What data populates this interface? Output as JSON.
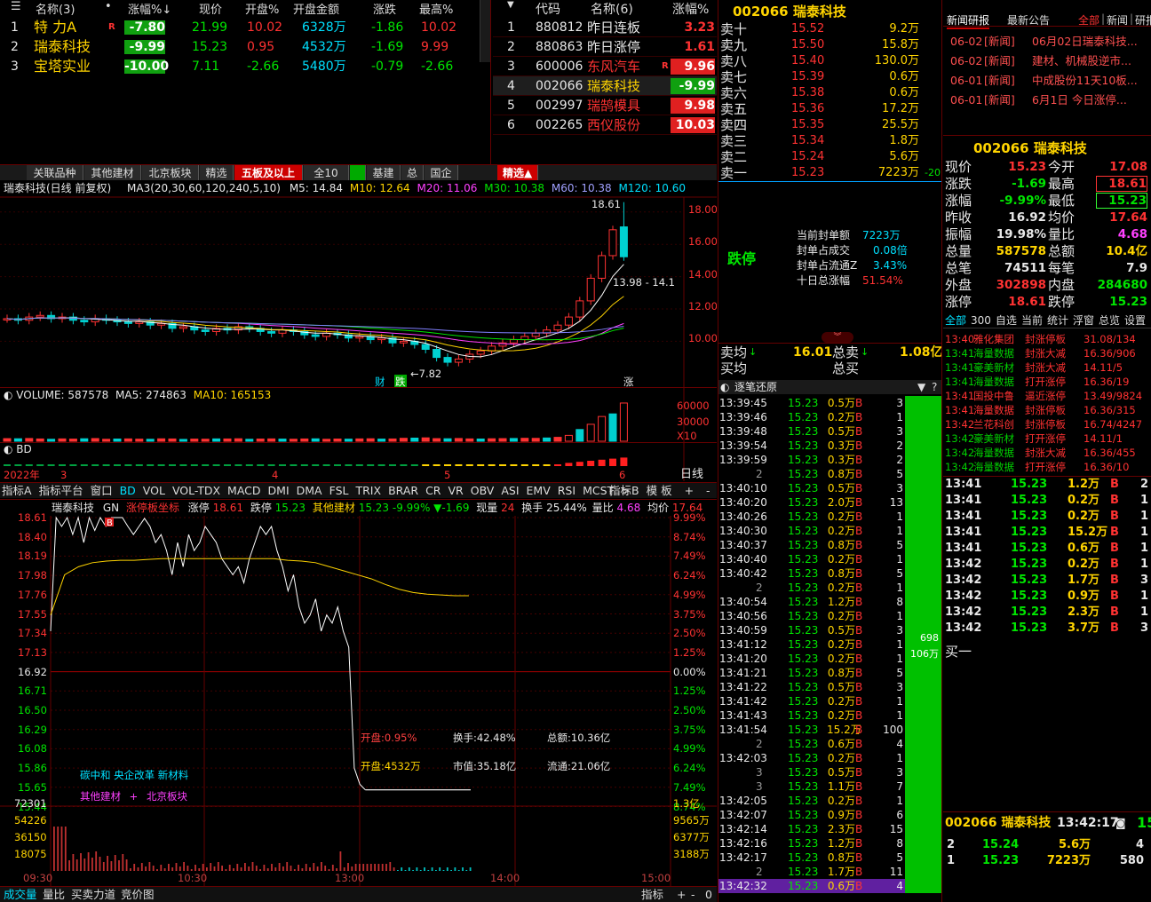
{
  "wl1": {
    "headers": [
      "名称(3)",
      "•",
      "涨幅%↓",
      "现价",
      "开盘%",
      "开盘金额",
      "涨跌",
      "最高%"
    ],
    "rows": [
      {
        "n": "1",
        "name": "特 力A",
        "tag": "R",
        "chg": "-7.80",
        "price": "21.99",
        "open": "10.02",
        "amt": "6328万",
        "diff": "-1.86",
        "high": "10.02"
      },
      {
        "n": "2",
        "name": "瑞泰科技",
        "tag": "",
        "chg": "-9.99",
        "price": "15.23",
        "open": "0.95",
        "amt": "4532万",
        "diff": "-1.69",
        "high": "9.99"
      },
      {
        "n": "3",
        "name": "宝塔实业",
        "tag": "",
        "chg": "-10.00",
        "price": "7.11",
        "open": "-2.66",
        "amt": "5480万",
        "diff": "-0.79",
        "high": "-2.66"
      }
    ]
  },
  "wl2": {
    "headers": [
      "代码",
      "名称(6)",
      "涨幅%"
    ],
    "rows": [
      {
        "n": "1",
        "code": "880812",
        "name": "昨日连板",
        "tag": "",
        "chg": "3.23"
      },
      {
        "n": "2",
        "code": "880863",
        "name": "昨日涨停",
        "tag": "",
        "chg": "1.61"
      },
      {
        "n": "3",
        "code": "600006",
        "name": "东风汽车",
        "tag": "R",
        "chg": "9.96"
      },
      {
        "n": "4",
        "code": "002066",
        "name": "瑞泰科技",
        "tag": "",
        "chg": "-9.99"
      },
      {
        "n": "5",
        "code": "002997",
        "name": "瑞鹄模具",
        "tag": "",
        "chg": "9.98"
      },
      {
        "n": "6",
        "code": "002265",
        "name": "西仪股份",
        "tag": "",
        "chg": "10.03"
      }
    ]
  },
  "tabs": [
    "关联品种",
    "其他建材",
    "北京板块",
    "精选",
    "五板及以上",
    "全10",
    "",
    "基建",
    "总",
    "国企"
  ],
  "tab_right": "精选▲",
  "kline": {
    "title": "瑞泰科技(日线 前复权)",
    "ma_label": "MA3(20,30,60,120,240,5,10)",
    "m5": "M5: 14.84",
    "m10": "M10: 12.64",
    "m20": "M20: 11.06",
    "m30": "M30: 10.38",
    "m60": "M60: 10.38",
    "m120": "M120: 10.60",
    "yticks": [
      "18.00",
      "16.00",
      "14.00",
      "12.00",
      "10.00"
    ],
    "high_label": "18.61",
    "low_label": "7.82",
    "range_label": "13.98 - 14.1",
    "marks": [
      "财",
      "跌",
      "涨"
    ],
    "closes": [
      11.4,
      11.3,
      11.5,
      11.6,
      11.4,
      11.5,
      11.3,
      11.2,
      11.4,
      11.3,
      11.2,
      11.1,
      11.2,
      11.0,
      11.1,
      10.8,
      10.9,
      10.7,
      10.6,
      10.8,
      10.7,
      10.9,
      10.8,
      10.6,
      10.5,
      10.7,
      10.6,
      10.4,
      10.3,
      10.5,
      10.4,
      10.2,
      10.3,
      10.1,
      10.2,
      9.9,
      10.0,
      9.8,
      9.5,
      9.0,
      8.7,
      8.9,
      9.2,
      9.4,
      9.7,
      9.9,
      10.1,
      10.3,
      10.5,
      10.7,
      11.0,
      11.5,
      12.5,
      13.9,
      15.3,
      16.9,
      15.23
    ]
  },
  "vol": {
    "label": "VOLUME: 587578",
    "ma5": "MA5: 274863",
    "ma10": "MA10: 165153",
    "ticks": [
      "60000",
      "30000",
      "X10"
    ],
    "values": [
      40,
      38,
      42,
      35,
      30,
      36,
      33,
      38,
      41,
      30,
      34,
      36,
      32,
      30,
      37,
      35,
      28,
      33,
      31,
      36,
      35,
      38,
      30,
      34,
      36,
      33,
      31,
      35,
      37,
      30,
      34,
      32,
      36,
      38,
      33,
      35,
      45,
      48,
      52,
      40,
      38,
      42,
      36,
      34,
      38,
      40,
      42,
      45,
      44,
      50,
      60,
      90,
      180,
      260,
      380,
      420,
      587
    ]
  },
  "bd": {
    "label": "BD",
    "years": [
      "2022年",
      "3",
      "4",
      "5",
      "6"
    ],
    "right": "日线"
  },
  "indicators": {
    "left": [
      "指标A",
      "指标平台",
      "窗口",
      "BD",
      "VOL",
      "VOL-TDX",
      "MACD",
      "DMI",
      "DMA",
      "FSL",
      "TRIX",
      "BRAR",
      "CR",
      "VR",
      "OBV",
      "ASI",
      "EMV",
      "RSI",
      "MCST",
      ">"
    ],
    "right": [
      "指标B",
      "模",
      "板"
    ],
    "ctl": [
      "+",
      "-",
      "0"
    ]
  },
  "intraday": {
    "name": "瑞泰科技",
    "gn": "GN",
    "zt_label": "涨停板坐标",
    "zt": "涨停",
    "zt_val": "18.61",
    "dt": "跌停",
    "dt_val": "15.23",
    "sector": "其他建材",
    "sector_val": "15.23",
    "sector_chg": "-9.99%",
    "sector_diff": "▼-1.69",
    "xl": "现量",
    "xl_val": "24",
    "hs": "换手",
    "hs_val": "25.44%",
    "lb": "量比",
    "lb_val": "4.68",
    "jj": "均价",
    "jj_val": "17.64",
    "yleft": [
      "18.61",
      "18.40",
      "18.19",
      "17.98",
      "17.76",
      "17.55",
      "17.34",
      "17.13",
      "16.92",
      "16.71",
      "16.50",
      "16.29",
      "16.08",
      "15.86",
      "15.65",
      "15.44"
    ],
    "yright": [
      "9.99%",
      "8.74%",
      "7.49%",
      "6.24%",
      "4.99%",
      "3.75%",
      "2.50%",
      "1.25%",
      "0.00%",
      "1.25%",
      "2.50%",
      "3.75%",
      "4.99%",
      "6.24%",
      "7.49%",
      "8.74%"
    ],
    "vleft": [
      "72301",
      "54226",
      "36150",
      "18075"
    ],
    "vright": [
      "1.3亿",
      "9565万",
      "6377万",
      "3188万"
    ],
    "times": [
      "09:30",
      "10:30",
      "13:00",
      "14:00",
      "15:00"
    ],
    "info1": "开盘:0.95%",
    "info2": "开盘:4532万",
    "info3": "换手:42.48%",
    "info4": "总额:10.36亿",
    "info5": "市值:35.18亿",
    "info6": "流通:21.06亿",
    "concept1": "碳中和 央企改革 新材料",
    "concept2": "其他建材",
    "concept_sep": "+",
    "concept3": "北京板块",
    "prices": [
      17.2,
      18.61,
      18.5,
      18.61,
      18.4,
      18.61,
      18.3,
      18.61,
      18.45,
      18.61,
      18.5,
      18.61,
      18.61,
      18.61,
      18.5,
      18.4,
      18.5,
      18.6,
      18.5,
      18.3,
      18.4,
      18.2,
      17.9,
      18.3,
      18.0,
      18.4,
      18.2,
      18.3,
      18.5,
      18.4,
      18.3,
      18.1,
      18.0,
      17.9,
      18.0,
      17.8,
      18.1,
      18.3,
      18.5,
      18.4,
      18.5,
      18.2,
      18.0,
      17.7,
      17.9,
      17.5,
      17.3,
      17.4,
      17.6,
      17.2,
      17.4,
      17.3,
      17.5,
      17.2,
      17.0,
      15.5,
      15.3,
      15.23
    ],
    "avg": [
      17.4,
      17.9,
      18.0,
      18.05,
      18.07,
      18.08,
      18.08,
      18.09,
      18.1,
      18.1,
      18.1,
      18.1,
      18.1,
      18.1,
      18.1,
      18.1,
      18.1,
      18.08,
      18.07,
      18.05,
      18.0,
      17.95,
      17.9,
      17.85,
      17.78,
      17.72,
      17.68,
      17.66,
      17.65,
      17.64,
      17.64
    ]
  },
  "bottom": {
    "tabs": [
      "成交量",
      "量比",
      "买卖力道",
      "竞价图"
    ],
    "right": "指标",
    "ctl": [
      "+",
      "-",
      "0"
    ]
  },
  "book": {
    "title": "002066 瑞泰科技",
    "sells": [
      {
        "l": "卖十",
        "p": "15.52",
        "v": "9.2万"
      },
      {
        "l": "卖九",
        "p": "15.50",
        "v": "15.8万"
      },
      {
        "l": "卖八",
        "p": "15.40",
        "v": "130.0万"
      },
      {
        "l": "卖七",
        "p": "15.39",
        "v": "0.6万"
      },
      {
        "l": "卖六",
        "p": "15.38",
        "v": "0.6万"
      },
      {
        "l": "卖五",
        "p": "15.36",
        "v": "17.2万"
      },
      {
        "l": "卖四",
        "p": "15.35",
        "v": "25.5万"
      },
      {
        "l": "卖三",
        "p": "15.34",
        "v": "1.8万"
      },
      {
        "l": "卖二",
        "p": "15.24",
        "v": "5.6万"
      },
      {
        "l": "卖一",
        "p": "15.23",
        "v": "7223万",
        "e": "-20"
      }
    ],
    "status": "跌停",
    "seal": [
      [
        "当前封单额",
        "7223万"
      ],
      [
        "封单占成交",
        "0.08倍"
      ],
      [
        "封单占流通Z",
        "3.43%"
      ],
      [
        "十日总涨幅",
        "51.54%"
      ]
    ],
    "avg_sell": "卖均",
    "avg_sell_val": "16.01",
    "total_sell": "总卖",
    "total_sell_val": "1.08亿",
    "avg_buy": "买均",
    "total_buy": "总买"
  },
  "ticks": {
    "title": "逐笔还原",
    "rows": [
      [
        "13:39:45",
        "15.23",
        "0.5万",
        "B",
        "3"
      ],
      [
        "13:39:46",
        "15.23",
        "0.2万",
        "B",
        "1"
      ],
      [
        "13:39:48",
        "15.23",
        "0.5万",
        "B",
        "3"
      ],
      [
        "13:39:54",
        "15.23",
        "0.3万",
        "B",
        "2"
      ],
      [
        "13:39:59",
        "15.23",
        "0.3万",
        "B",
        "2"
      ],
      [
        "2",
        "15.23",
        "0.8万",
        "B",
        "5"
      ],
      [
        "13:40:10",
        "15.23",
        "0.5万",
        "B",
        "3"
      ],
      [
        "13:40:20",
        "15.23",
        "2.0万",
        "B",
        "13"
      ],
      [
        "13:40:26",
        "15.23",
        "0.2万",
        "B",
        "1"
      ],
      [
        "13:40:30",
        "15.23",
        "0.2万",
        "B",
        "1"
      ],
      [
        "13:40:37",
        "15.23",
        "0.8万",
        "B",
        "5"
      ],
      [
        "13:40:40",
        "15.23",
        "0.2万",
        "B",
        "1"
      ],
      [
        "13:40:42",
        "15.23",
        "0.8万",
        "B",
        "5"
      ],
      [
        "2",
        "15.23",
        "0.2万",
        "B",
        "1"
      ],
      [
        "13:40:54",
        "15.23",
        "1.2万",
        "B",
        "8"
      ],
      [
        "13:40:56",
        "15.23",
        "0.2万",
        "B",
        "1"
      ],
      [
        "13:40:59",
        "15.23",
        "0.5万",
        "B",
        "3"
      ],
      [
        "13:41:12",
        "15.23",
        "0.2万",
        "B",
        "1"
      ],
      [
        "13:41:20",
        "15.23",
        "0.2万",
        "B",
        "1"
      ],
      [
        "13:41:21",
        "15.23",
        "0.8万",
        "B",
        "5"
      ],
      [
        "13:41:22",
        "15.23",
        "0.5万",
        "B",
        "3"
      ],
      [
        "13:41:42",
        "15.23",
        "0.2万",
        "B",
        "1"
      ],
      [
        "13:41:43",
        "15.23",
        "0.2万",
        "B",
        "1"
      ],
      [
        "13:41:54",
        "15.23",
        "15.2万",
        "B",
        "100"
      ],
      [
        "2",
        "15.23",
        "0.6万",
        "B",
        "4"
      ],
      [
        "13:42:03",
        "15.23",
        "0.2万",
        "B",
        "1"
      ],
      [
        "3",
        "15.23",
        "0.5万",
        "B",
        "3"
      ],
      [
        "3",
        "15.23",
        "1.1万",
        "B",
        "7"
      ],
      [
        "13:42:05",
        "15.23",
        "0.2万",
        "B",
        "1"
      ],
      [
        "13:42:07",
        "15.23",
        "0.9万",
        "B",
        "6"
      ],
      [
        "13:42:14",
        "15.23",
        "2.3万",
        "B",
        "15"
      ],
      [
        "13:42:16",
        "15.23",
        "1.2万",
        "B",
        "8"
      ],
      [
        "13:42:17",
        "15.23",
        "0.8万",
        "B",
        "5"
      ],
      [
        "2",
        "15.23",
        "1.7万",
        "B",
        "11"
      ],
      [
        "13:42:32",
        "15.23",
        "0.6万",
        "B",
        "4"
      ]
    ],
    "bar1": "698",
    "bar2": "106万"
  },
  "news": {
    "tabs": [
      "新闻研报",
      "最新公告",
      "全部",
      "新闻",
      "研报"
    ],
    "items": [
      [
        "06-02",
        "[新闻]",
        "06月02日瑞泰科技..."
      ],
      [
        "06-02",
        "[新闻]",
        "建材、机械股逆市..."
      ],
      [
        "06-01",
        "[新闻]",
        "中成股份11天10板..."
      ],
      [
        "06-01",
        "[新闻]",
        "6月1日 今日涨停..."
      ]
    ]
  },
  "quote": {
    "title": "002066 瑞泰科技",
    "rows": [
      [
        "现价",
        "15.23",
        "今开",
        "17.08"
      ],
      [
        "涨跌",
        "-1.69",
        "最高",
        "18.61"
      ],
      [
        "涨幅",
        "-9.99%",
        "最低",
        "15.23"
      ],
      [
        "昨收",
        "16.92",
        "均价",
        "17.64"
      ],
      [
        "振幅",
        "19.98%",
        "量比",
        "4.68"
      ],
      [
        "总量",
        "587578",
        "总额",
        "10.4亿"
      ],
      [
        "总笔",
        "74511",
        "每笔",
        "7.9"
      ],
      [
        "外盘",
        "302898",
        "内盘",
        "284680"
      ],
      [
        "涨停",
        "18.61",
        "跌停",
        "15.23"
      ]
    ]
  },
  "menu": [
    "全部",
    "300",
    "自选",
    "当前",
    "统计",
    "浮窗",
    "总览",
    "设置"
  ],
  "alerts": [
    [
      "13:40",
      "雅化集团",
      "封涨停板",
      "31.08/134"
    ],
    [
      "13:41",
      "海量数据",
      "封涨大减",
      "16.36/906"
    ],
    [
      "13:41",
      "豪美新材",
      "封涨大减",
      "14.11/5"
    ],
    [
      "13:41",
      "海量数据",
      "打开涨停",
      "16.36/19"
    ],
    [
      "13:41",
      "国投中鲁",
      "逼近涨停",
      "13.49/9824"
    ],
    [
      "13:41",
      "海量数据",
      "封涨停板",
      "16.36/315"
    ],
    [
      "13:42",
      "兰花科创",
      "封涨停板",
      "16.74/4247"
    ],
    [
      "13:42",
      "豪美新材",
      "打开涨停",
      "14.11/1"
    ],
    [
      "13:42",
      "海量数据",
      "封涨大减",
      "16.36/455"
    ],
    [
      "13:42",
      "海量数据",
      "打开涨停",
      "16.36/10"
    ]
  ],
  "trades": [
    [
      "13:41",
      "15.23",
      "1.2万",
      "B",
      "2"
    ],
    [
      "13:41",
      "15.23",
      "0.2万",
      "B",
      "1"
    ],
    [
      "13:41",
      "15.23",
      "0.2万",
      "B",
      "1"
    ],
    [
      "13:41",
      "15.23",
      "15.2万",
      "B",
      "1"
    ],
    [
      "13:41",
      "15.23",
      "0.6万",
      "B",
      "1"
    ],
    [
      "13:42",
      "15.23",
      "0.2万",
      "B",
      "1"
    ],
    [
      "13:42",
      "15.23",
      "1.7万",
      "B",
      "3"
    ],
    [
      "13:42",
      "15.23",
      "0.9万",
      "B",
      "1"
    ],
    [
      "13:42",
      "15.23",
      "2.3万",
      "B",
      "1"
    ],
    [
      "13:42",
      "15.23",
      "3.7万",
      "B",
      "3"
    ]
  ],
  "buy1": "买一",
  "mini": {
    "title": "002066 瑞泰科技",
    "time": "13:42:17",
    "rows": [
      [
        "2",
        "15.24",
        "5.6万",
        "4"
      ],
      [
        "1",
        "15.23",
        "7223万",
        "580"
      ]
    ]
  }
}
